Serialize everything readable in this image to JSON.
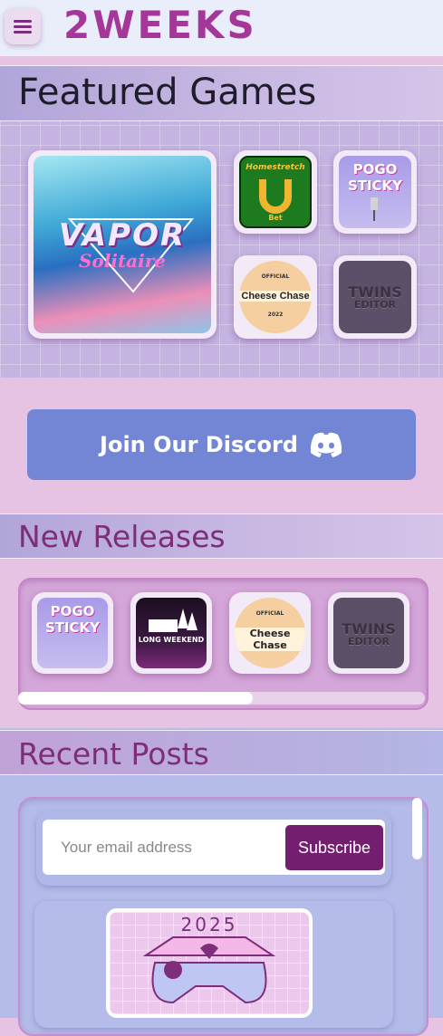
{
  "header": {
    "logo": "2WEEKS",
    "menu_icon": "hamburger-icon"
  },
  "featured": {
    "title": "Featured Games",
    "games": [
      {
        "name": "VAPOR",
        "subtitle": "Solitaire"
      },
      {
        "name": "Homestretch",
        "subtitle": "Bet"
      },
      {
        "name": "POGO",
        "subtitle": "STICKY"
      },
      {
        "name": "Cheese Chase",
        "badge_top": "OFFICIAL",
        "badge_ring": "2022"
      },
      {
        "name": "TWINS",
        "subtitle": "EDITOR"
      }
    ]
  },
  "discord": {
    "label": "Join Our Discord",
    "icon": "discord-icon"
  },
  "new_releases": {
    "title": "New Releases",
    "games": [
      {
        "name": "POGO",
        "subtitle": "STICKY"
      },
      {
        "name": "LONG WEEKEND"
      },
      {
        "name": "Cheese Chase",
        "badge_top": "OFFICIAL"
      },
      {
        "name": "TWINS",
        "subtitle": "EDITOR"
      }
    ]
  },
  "recent_posts": {
    "title": "Recent Posts",
    "email_placeholder": "Your email address",
    "subscribe_label": "Subscribe",
    "post_year": "2025"
  },
  "colors": {
    "brand": "#a5379a",
    "discord": "#7386d6",
    "subscribe": "#741e6f"
  }
}
